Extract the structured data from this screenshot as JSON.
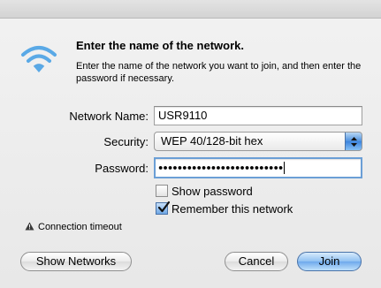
{
  "dialog": {
    "heading": "Enter the name of the network.",
    "description": "Enter the name of the network you want to join, and then enter the password if necessary."
  },
  "icons": {
    "wifi": "wifi-icon",
    "warning": "warning-icon",
    "popup_arrows": "chevron-up-down-icon",
    "checkmark": "checkmark-icon"
  },
  "form": {
    "network_name_label": "Network Name:",
    "network_name_value": "USR9110",
    "security_label": "Security:",
    "security_value": "WEP 40/128-bit hex",
    "password_label": "Password:",
    "password_mask": "●●●●●●●●●●●●●●●●●●●●●●●●●●",
    "show_password_label": "Show password",
    "show_password_checked": false,
    "remember_label": "Remember this network",
    "remember_checked": true
  },
  "status": {
    "warning_text": "Connection timeout"
  },
  "buttons": {
    "show_networks": "Show Networks",
    "cancel": "Cancel",
    "join": "Join"
  },
  "colors": {
    "accent": "#4a8fdf",
    "wifi_blue": "#5aa9e6",
    "focus_ring": "#6b9fd6"
  }
}
